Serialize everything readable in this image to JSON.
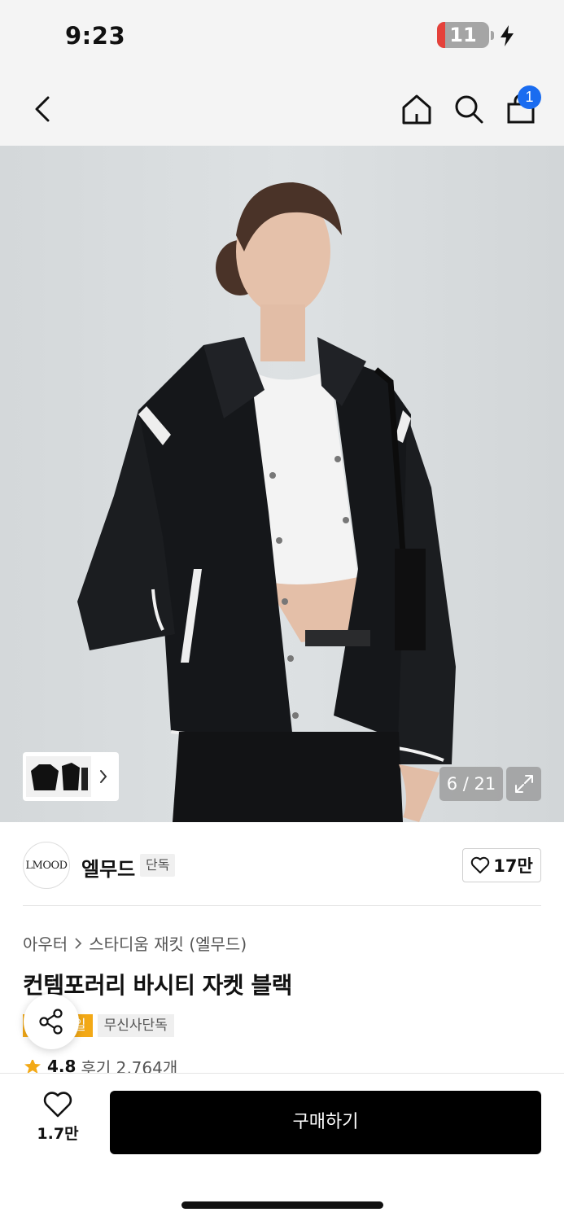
{
  "status_bar": {
    "time": "9:23",
    "battery_level": "11",
    "battery_fraction": 0.11,
    "battery_color": "#e5413a",
    "charging_icon": "bolt-icon"
  },
  "nav": {
    "back_icon": "chevron-left-icon",
    "home_icon": "home-icon",
    "search_icon": "search-icon",
    "cart_icon": "shopping-bag-icon",
    "cart_badge": "1",
    "badge_color": "#1a6cf0"
  },
  "gallery": {
    "counter": "6 / 21",
    "expand_icon": "expand-icon",
    "thumbnail_arrow_icon": "chevron-right-icon"
  },
  "brand": {
    "logo_text": "LMOOD",
    "name": "엘무드",
    "tag": "단독",
    "like_count": "17만",
    "like_icon": "heart-outline-icon"
  },
  "product": {
    "breadcrumb": [
      "아우터",
      "스타디움 재킷 (엘무드)"
    ],
    "title": "컨템포러리 바시티 자켓 블랙",
    "badges": {
      "orange": "일",
      "gray": "무신사단독"
    },
    "badge_color": "#f3a916",
    "share_icon": "share-icon",
    "rating": {
      "star_icon": "star-icon",
      "score": "4.8",
      "review_text": "후기 2,764개"
    }
  },
  "bottom_bar": {
    "wish_icon": "heart-outline-icon",
    "wish_count": "1.7만",
    "buy_label": "구매하기"
  }
}
